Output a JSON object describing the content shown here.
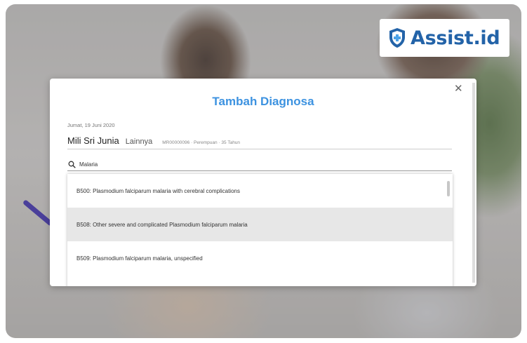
{
  "brand": {
    "name": "Assist.id",
    "color": "#2363a8",
    "icon": "shield-cross-icon"
  },
  "modal": {
    "title": "Tambah Diagnosa",
    "close_icon": "close-icon",
    "date": "Jumat, 19 Juni 2020",
    "patient": {
      "name": "Mili Sri Junia",
      "type": "Lainnya",
      "meta": "MR00000096 · Perempuan · 35 Tahun"
    },
    "search": {
      "icon": "search-icon",
      "value": "Malaria"
    },
    "results": [
      {
        "label": "B500: Plasmodium falciparum malaria with cerebral complications"
      },
      {
        "label": "B508: Other severe and complicated Plasmodium falciparum malaria",
        "highlighted": true
      },
      {
        "label": "B509: Plasmodium falciparum malaria, unspecified"
      }
    ]
  },
  "colors": {
    "title": "#3c92e0",
    "highlight": "#e7e7e7"
  }
}
